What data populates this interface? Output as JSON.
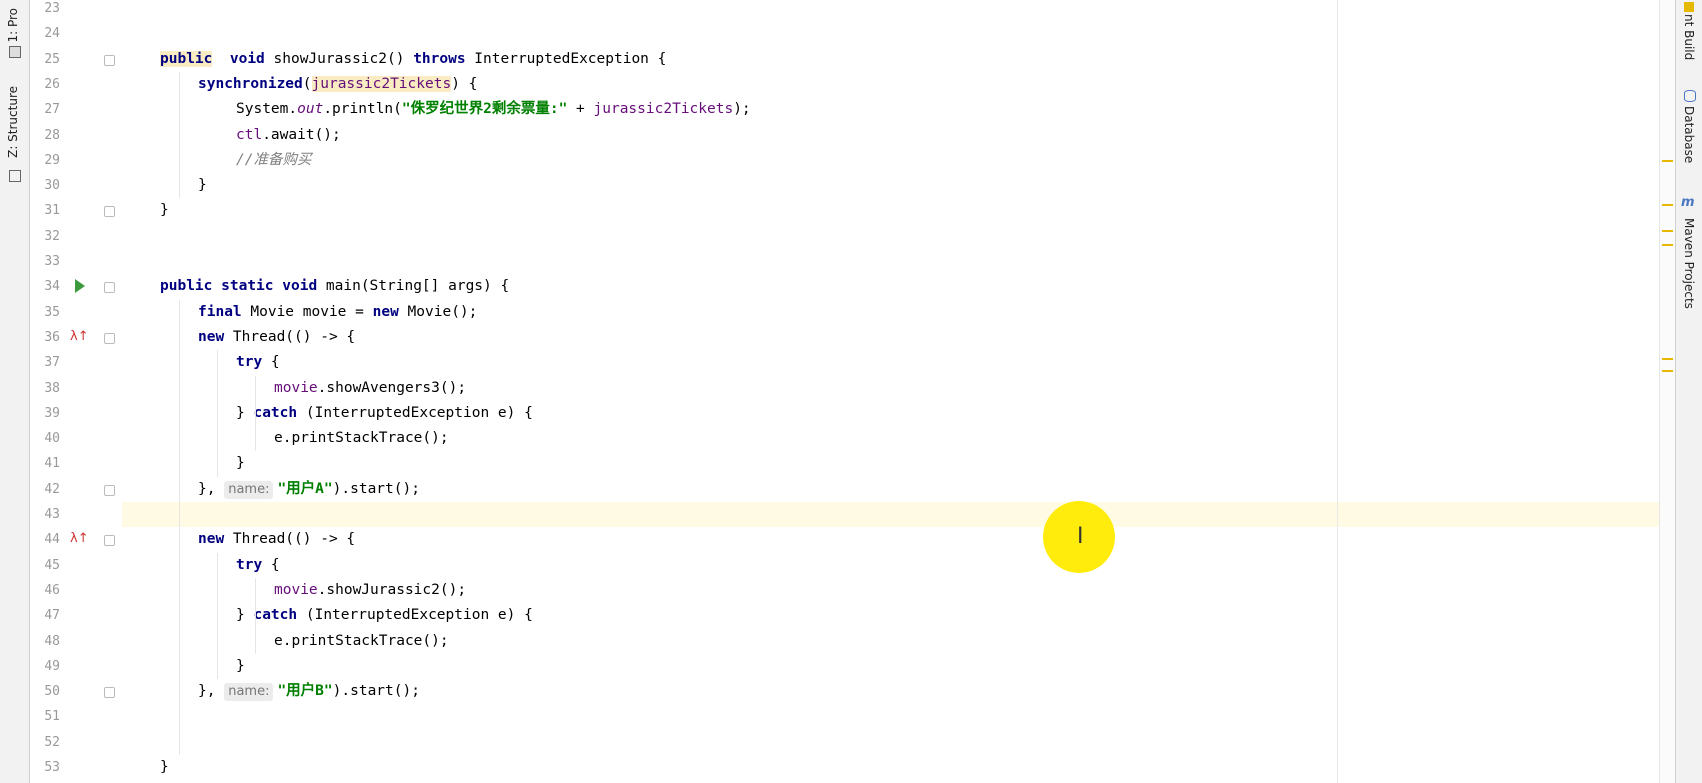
{
  "left_toolbar": {
    "tab_project": "1: Pro",
    "tab_structure": "Z: Structure"
  },
  "right_toolbar": {
    "tab_ant": "nt Build",
    "tab_database": "Database",
    "tab_maven": "Maven Projects"
  },
  "lines": [
    {
      "n": "23",
      "segs": []
    },
    {
      "n": "24",
      "segs": []
    },
    {
      "n": "25",
      "indent": 0,
      "fold": true,
      "segs": [
        {
          "t": "public",
          "c": "kw hl"
        },
        {
          "t": "  "
        },
        {
          "t": "void",
          "c": "kw"
        },
        {
          "t": " showJurassic2() "
        },
        {
          "t": "throws",
          "c": "kw"
        },
        {
          "t": " InterruptedException {"
        }
      ]
    },
    {
      "n": "26",
      "indent": 1,
      "segs": [
        {
          "t": "synchronized",
          "c": "kw"
        },
        {
          "t": "("
        },
        {
          "t": "jurassic2Tickets",
          "c": "fld hl"
        },
        {
          "t": ") {"
        }
      ]
    },
    {
      "n": "27",
      "indent": 2,
      "segs": [
        {
          "t": "System."
        },
        {
          "t": "out",
          "c": "fld ital"
        },
        {
          "t": ".println("
        },
        {
          "t": "\"侏罗纪世界2剩余票量:\"",
          "c": "str"
        },
        {
          "t": " + "
        },
        {
          "t": "jurassic2Tickets",
          "c": "fld"
        },
        {
          "t": ");"
        }
      ]
    },
    {
      "n": "28",
      "indent": 2,
      "segs": [
        {
          "t": "ctl",
          "c": "fld"
        },
        {
          "t": ".await();"
        }
      ]
    },
    {
      "n": "29",
      "indent": 2,
      "segs": [
        {
          "t": "//准备购买",
          "c": "cmt"
        }
      ]
    },
    {
      "n": "30",
      "indent": 1,
      "segs": [
        {
          "t": "}"
        }
      ]
    },
    {
      "n": "31",
      "indent": 0,
      "fold": true,
      "segs": [
        {
          "t": "}"
        }
      ]
    },
    {
      "n": "32",
      "segs": []
    },
    {
      "n": "33",
      "segs": []
    },
    {
      "n": "34",
      "indent": 0,
      "run": true,
      "fold": true,
      "segs": [
        {
          "t": "public",
          "c": "kw"
        },
        {
          "t": " "
        },
        {
          "t": "static",
          "c": "kw"
        },
        {
          "t": " "
        },
        {
          "t": "void",
          "c": "kw"
        },
        {
          "t": " main(String[] args) {"
        }
      ]
    },
    {
      "n": "35",
      "indent": 1,
      "segs": [
        {
          "t": "final",
          "c": "kw"
        },
        {
          "t": " Movie movie = "
        },
        {
          "t": "new",
          "c": "kw"
        },
        {
          "t": " Movie();"
        }
      ]
    },
    {
      "n": "36",
      "indent": 1,
      "ovr": true,
      "fold": true,
      "segs": [
        {
          "t": "new",
          "c": "kw"
        },
        {
          "t": " Thread(() -> {"
        }
      ]
    },
    {
      "n": "37",
      "indent": 2,
      "segs": [
        {
          "t": "try",
          "c": "kw"
        },
        {
          "t": " {"
        }
      ]
    },
    {
      "n": "38",
      "indent": 3,
      "segs": [
        {
          "t": "movie",
          "c": "fld"
        },
        {
          "t": ".showAvengers3();"
        }
      ]
    },
    {
      "n": "39",
      "indent": 2,
      "segs": [
        {
          "t": "} "
        },
        {
          "t": "catch",
          "c": "kw"
        },
        {
          "t": " (InterruptedException e) {"
        }
      ]
    },
    {
      "n": "40",
      "indent": 3,
      "segs": [
        {
          "t": "e.printStackTrace();"
        }
      ]
    },
    {
      "n": "41",
      "indent": 2,
      "segs": [
        {
          "t": "}"
        }
      ]
    },
    {
      "n": "42",
      "indent": 1,
      "fold": true,
      "segs": [
        {
          "t": "}, "
        },
        {
          "t": "name:",
          "c": "hint"
        },
        {
          "t": "\"用户A\"",
          "c": "str"
        },
        {
          "t": ").start();"
        }
      ]
    },
    {
      "n": "43",
      "current": true,
      "segs": []
    },
    {
      "n": "44",
      "indent": 1,
      "ovr": true,
      "fold": true,
      "segs": [
        {
          "t": "new",
          "c": "kw"
        },
        {
          "t": " Thread(() -> {"
        }
      ]
    },
    {
      "n": "45",
      "indent": 2,
      "segs": [
        {
          "t": "try",
          "c": "kw"
        },
        {
          "t": " {"
        }
      ]
    },
    {
      "n": "46",
      "indent": 3,
      "segs": [
        {
          "t": "movie",
          "c": "fld"
        },
        {
          "t": ".showJurassic2();"
        }
      ]
    },
    {
      "n": "47",
      "indent": 2,
      "segs": [
        {
          "t": "} "
        },
        {
          "t": "catch",
          "c": "kw"
        },
        {
          "t": " (InterruptedException e) {"
        }
      ]
    },
    {
      "n": "48",
      "indent": 3,
      "segs": [
        {
          "t": "e.printStackTrace();"
        }
      ]
    },
    {
      "n": "49",
      "indent": 2,
      "segs": [
        {
          "t": "}"
        }
      ]
    },
    {
      "n": "50",
      "indent": 1,
      "fold": true,
      "segs": [
        {
          "t": "}, "
        },
        {
          "t": "name:",
          "c": "hint"
        },
        {
          "t": "\"用户B\"",
          "c": "str"
        },
        {
          "t": ").start();"
        }
      ]
    },
    {
      "n": "51",
      "segs": []
    },
    {
      "n": "52",
      "segs": []
    },
    {
      "n": "53",
      "indent": 0,
      "segs": [
        {
          "t": "}"
        }
      ]
    }
  ],
  "colors": {
    "keyword": "#000080",
    "string": "#008000",
    "field": "#660e7a",
    "comment": "#808080",
    "current_line": "#fffae3",
    "cursor_highlight": "#ffeb00"
  }
}
